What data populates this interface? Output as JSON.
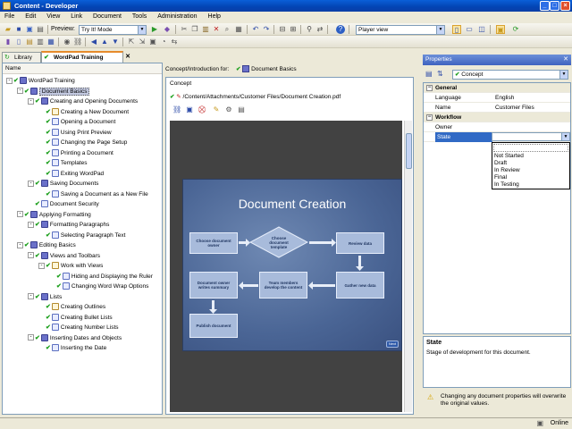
{
  "window": {
    "title": "Content - Developer"
  },
  "menu": [
    "File",
    "Edit",
    "View",
    "Link",
    "Document",
    "Tools",
    "Administration",
    "Help"
  ],
  "toolbar": {
    "preview_label": "Preview:",
    "preview_mode": "Try It! Mode",
    "player_view": "Player view"
  },
  "tabs": {
    "library": "Library",
    "active": "WordPad Training"
  },
  "tree": {
    "header": "Name",
    "items": [
      {
        "label": "WordPad Training",
        "depth": 0,
        "icon": "book",
        "expander": "-"
      },
      {
        "label": "Document Basics",
        "depth": 1,
        "icon": "book",
        "expander": "-",
        "selected": true
      },
      {
        "label": "Creating and Opening Documents",
        "depth": 2,
        "icon": "book",
        "expander": "-"
      },
      {
        "label": "Creating a New Document",
        "depth": 3,
        "icon": "doc"
      },
      {
        "label": "Opening a Document",
        "depth": 3,
        "icon": "page"
      },
      {
        "label": "Using Print Preview",
        "depth": 3,
        "icon": "page"
      },
      {
        "label": "Changing the Page Setup",
        "depth": 3,
        "icon": "page"
      },
      {
        "label": "Printing a Document",
        "depth": 3,
        "icon": "page"
      },
      {
        "label": "Templates",
        "depth": 3,
        "icon": "page"
      },
      {
        "label": "Exiting WordPad",
        "depth": 3,
        "icon": "page"
      },
      {
        "label": "Saving Documents",
        "depth": 2,
        "icon": "book",
        "expander": "-"
      },
      {
        "label": "Saving a Document as a New File",
        "depth": 3,
        "icon": "page"
      },
      {
        "label": "Document Security",
        "depth": 2,
        "icon": "page"
      },
      {
        "label": "Applying Formatting",
        "depth": 1,
        "icon": "book",
        "expander": "-"
      },
      {
        "label": "Formatting Paragraphs",
        "depth": 2,
        "icon": "book",
        "expander": "-"
      },
      {
        "label": "Selecting Paragraph Text",
        "depth": 3,
        "icon": "page"
      },
      {
        "label": "Editing Basics",
        "depth": 1,
        "icon": "book",
        "expander": "-"
      },
      {
        "label": "Views and Toolbars",
        "depth": 2,
        "icon": "book",
        "expander": "-"
      },
      {
        "label": "Work with Views",
        "depth": 3,
        "icon": "doc",
        "expander": "-"
      },
      {
        "label": "Hiding and Displaying the Ruler",
        "depth": 4,
        "icon": "page"
      },
      {
        "label": "Changing Word Wrap Options",
        "depth": 4,
        "icon": "page"
      },
      {
        "label": "Lists",
        "depth": 2,
        "icon": "book",
        "expander": "-"
      },
      {
        "label": "Creating Outlines",
        "depth": 3,
        "icon": "doc"
      },
      {
        "label": "Creating Bullet Lists",
        "depth": 3,
        "icon": "page"
      },
      {
        "label": "Creating Number Lists",
        "depth": 3,
        "icon": "page"
      },
      {
        "label": "Inserting Dates and Objects",
        "depth": 2,
        "icon": "book",
        "expander": "-"
      },
      {
        "label": "Inserting the Date",
        "depth": 3,
        "icon": "page"
      }
    ]
  },
  "middle": {
    "header_prefix": "Concept/Introduction for:",
    "header_item": "Document Basics",
    "concept_label": "Concept",
    "path": "/Content/Attachments/Customer Files/Document Creation.pdf",
    "slide": {
      "title": "Document Creation",
      "boxes": {
        "choose_owner": "Choose document owner",
        "choose_template": "Choose document template",
        "review_data": "Review data",
        "gather_data": "Gather new data",
        "team_members": "Team members develop the content",
        "owner_summary": "Document owner writes summary",
        "publish": "Publish document"
      },
      "next": "Next"
    }
  },
  "properties": {
    "title": "Properties",
    "selector": "Concept",
    "sections": {
      "general": "General",
      "workflow": "Workflow"
    },
    "rows": {
      "language_k": "Language",
      "language_v": "English",
      "name_k": "Name",
      "name_v": "Customer Files",
      "owner_k": "Owner",
      "state_k": "State"
    },
    "state_options": [
      "Not Started",
      "Draft",
      "In Review",
      "Final",
      "In Testing"
    ],
    "desc_title": "State",
    "desc_text": "Stage of development for this document.",
    "warning": "Changing any document properties will overwrite the original values."
  },
  "status": {
    "text": "Online"
  }
}
